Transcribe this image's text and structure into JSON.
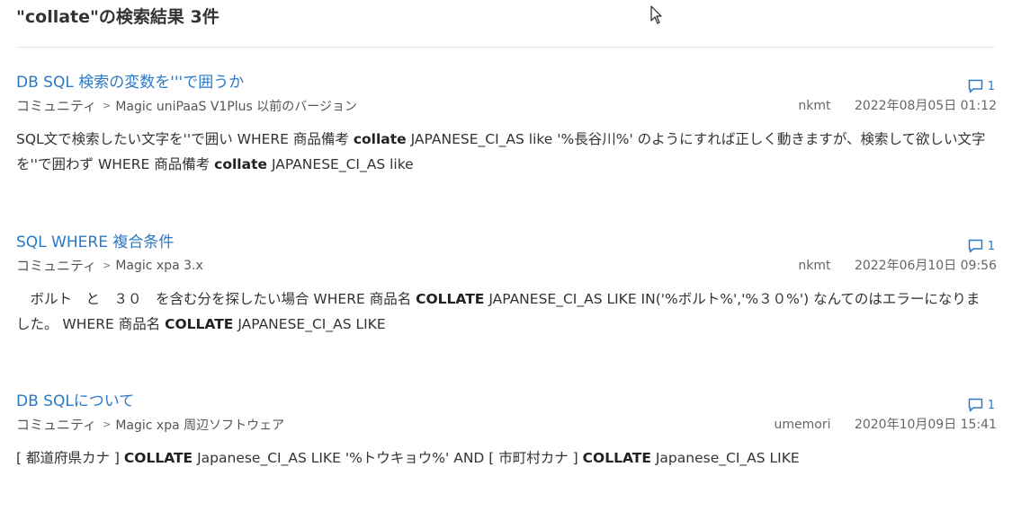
{
  "search": {
    "heading": "\"collate\"の検索結果 3件"
  },
  "results": [
    {
      "title": "DB SQL 検索の変数を'''で囲うか",
      "comment_count": "1",
      "breadcrumb_root": "コミュニティ",
      "breadcrumb_separator": ">",
      "breadcrumb_leaf": "Magic uniPaaS V1Plus 以前のバージョン",
      "author": "nkmt",
      "date": "2022年08月05日 01:12",
      "snippet": [
        {
          "text": "SQL文で検索したい文字を''で囲い WHERE 商品備考 ",
          "bold": false
        },
        {
          "text": "collate",
          "bold": true
        },
        {
          "text": " JAPANESE_CI_AS like '%長谷川%' のようにすれば正しく動きますが、検索して欲しい文字を''で囲わず WHERE 商品備考 ",
          "bold": false
        },
        {
          "text": "collate",
          "bold": true
        },
        {
          "text": " JAPANESE_CI_AS like",
          "bold": false
        }
      ]
    },
    {
      "title": "SQL WHERE 複合条件",
      "comment_count": "1",
      "breadcrumb_root": "コミュニティ",
      "breadcrumb_separator": ">",
      "breadcrumb_leaf": "Magic xpa 3.x",
      "author": "nkmt",
      "date": "2022年06月10日 09:56",
      "snippet": [
        {
          "text": "　ボルト　と　３０　を含む分を探したい場合 WHERE 商品名 ",
          "bold": false
        },
        {
          "text": "COLLATE",
          "bold": true
        },
        {
          "text": " JAPANESE_CI_AS LIKE IN('%ボルト%','%３０%') なんてのはエラーになりました。 WHERE 商品名 ",
          "bold": false
        },
        {
          "text": "COLLATE",
          "bold": true
        },
        {
          "text": " JAPANESE_CI_AS LIKE",
          "bold": false
        }
      ]
    },
    {
      "title": "DB SQLについて",
      "comment_count": "1",
      "breadcrumb_root": "コミュニティ",
      "breadcrumb_separator": ">",
      "breadcrumb_leaf": "Magic xpa 周辺ソフトウェア",
      "author": "umemori",
      "date": "2020年10月09日 15:41",
      "snippet": [
        {
          "text": "[ 都道府県カナ ] ",
          "bold": false
        },
        {
          "text": "COLLATE",
          "bold": true
        },
        {
          "text": " Japanese_CI_AS LIKE '%トウキョウ%' AND [ 市町村カナ ] ",
          "bold": false
        },
        {
          "text": "COLLATE",
          "bold": true
        },
        {
          "text": " Japanese_CI_AS LIKE",
          "bold": false
        }
      ]
    }
  ],
  "icons": {
    "comment": "speech-bubble-icon",
    "cursor": "mouse-pointer-icon"
  },
  "colors": {
    "link": "#2b78c4",
    "text": "#333333",
    "meta": "#666666",
    "divider": "#e4e4e4"
  }
}
